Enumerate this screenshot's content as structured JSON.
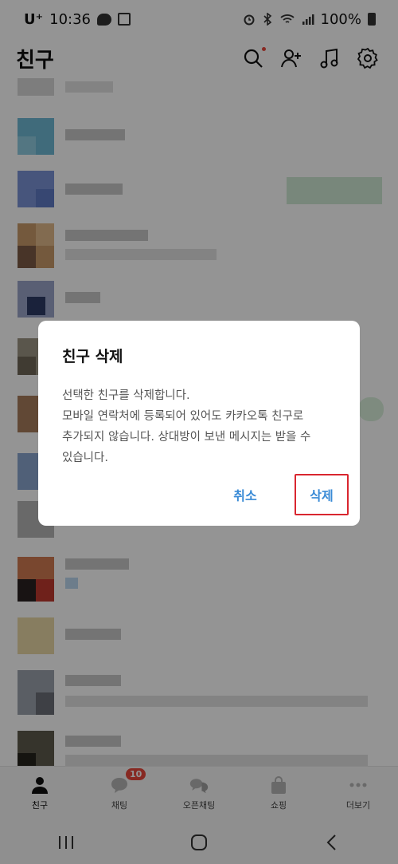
{
  "status_bar": {
    "carrier": "U⁺",
    "time": "10:36",
    "battery": "100%"
  },
  "header": {
    "title": "친구"
  },
  "bottom_nav": {
    "items": [
      {
        "label": "친구"
      },
      {
        "label": "채팅",
        "badge": "10"
      },
      {
        "label": "오픈채팅"
      },
      {
        "label": "쇼핑"
      },
      {
        "label": "더보기"
      }
    ]
  },
  "dialog": {
    "title": "친구 삭제",
    "message": "선택한 친구를 삭제합니다.\n모바일 연락처에 등록되어 있어도 카카오톡 친구로\n추가되지 않습니다. 상대방이 보낸 메시지는 받을 수\n있습니다.",
    "cancel_label": "취소",
    "delete_label": "삭제"
  },
  "colors": {
    "accent": "#3a8bd6",
    "highlight_border": "#d9262f",
    "badge": "#e8483c"
  }
}
